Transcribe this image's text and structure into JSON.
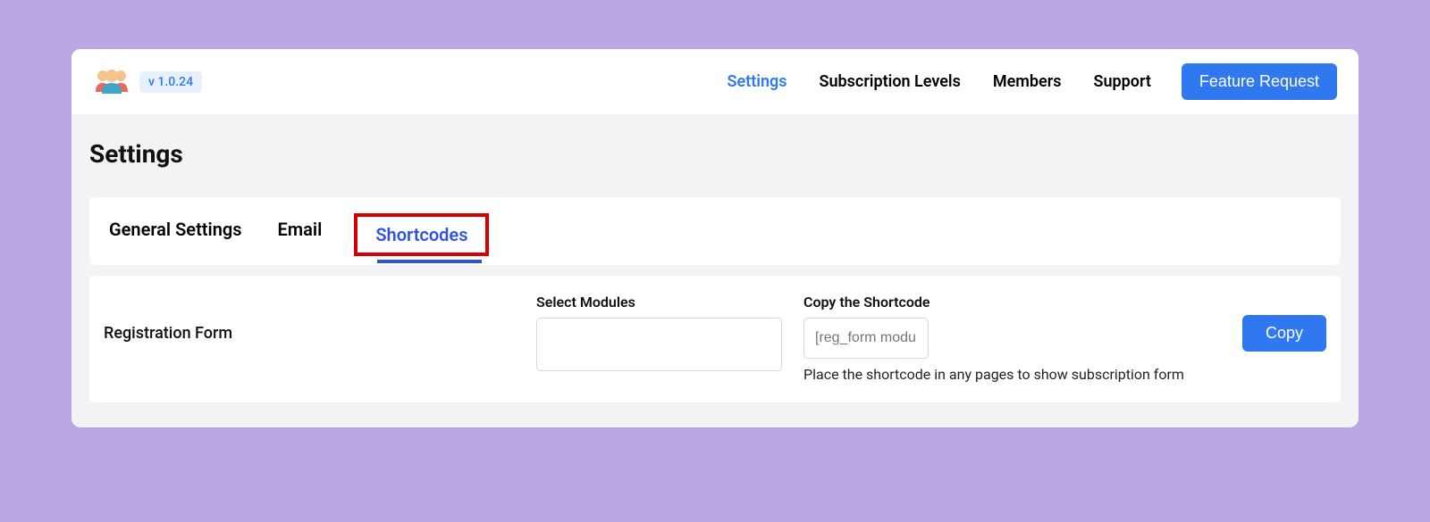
{
  "header": {
    "version": "v 1.0.24",
    "nav": {
      "settings": "Settings",
      "subscription_levels": "Subscription Levels",
      "members": "Members",
      "support": "Support"
    },
    "feature_request": "Feature Request"
  },
  "page": {
    "title": "Settings"
  },
  "tabs": {
    "general": "General Settings",
    "email": "Email",
    "shortcodes": "Shortcodes"
  },
  "shortcodes": {
    "row_label": "Registration Form",
    "modules_label": "Select Modules",
    "copy_label": "Copy the Shortcode",
    "shortcode_placeholder": "[reg_form module",
    "helper": "Place the shortcode in any pages to show subscription form",
    "copy_button": "Copy"
  }
}
